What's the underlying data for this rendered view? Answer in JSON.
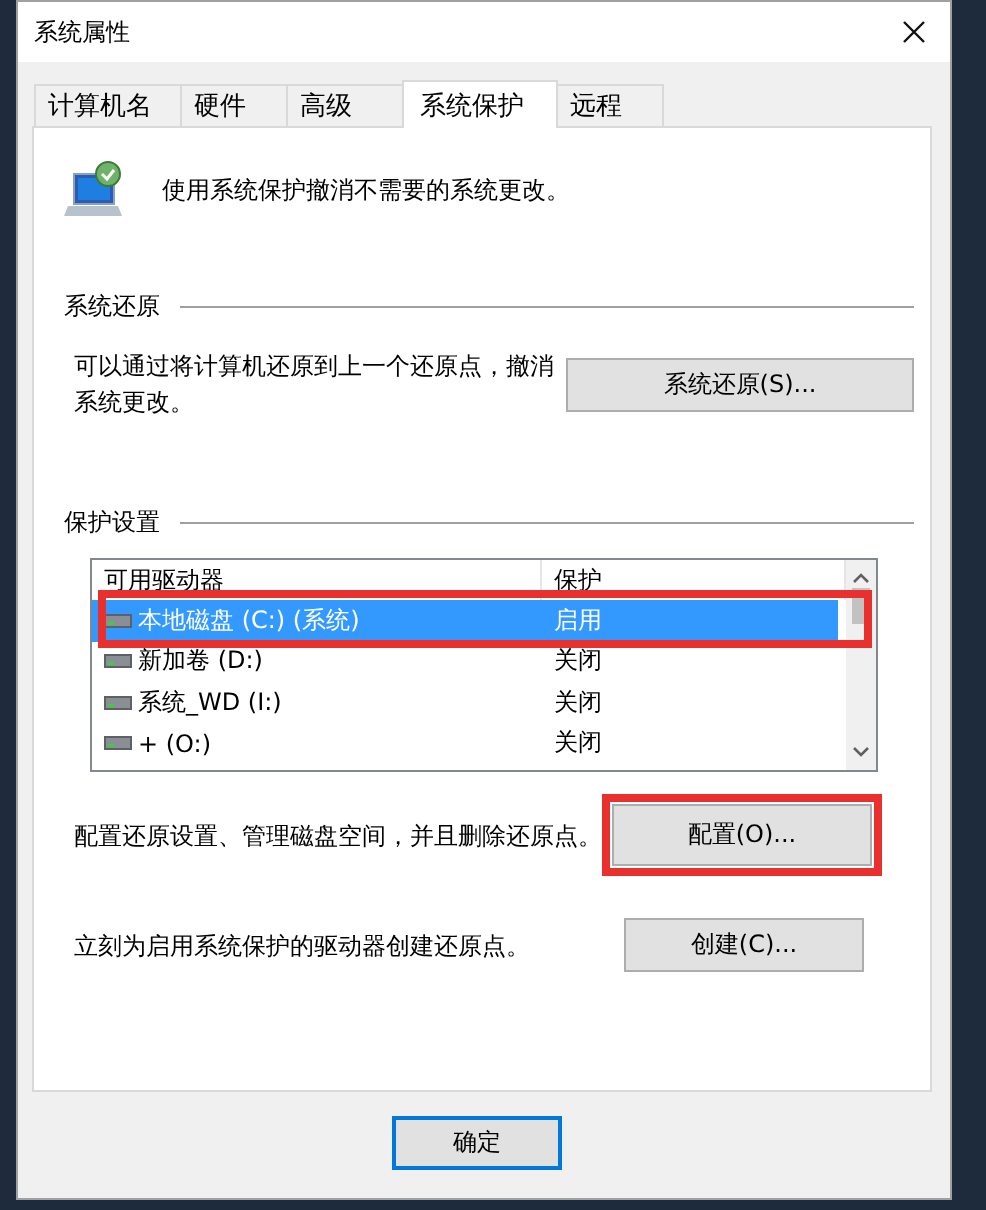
{
  "window": {
    "title": "系统属性"
  },
  "tabs": [
    {
      "label": "计算机名",
      "selected": false
    },
    {
      "label": "硬件",
      "selected": false
    },
    {
      "label": "高级",
      "selected": false
    },
    {
      "label": "系统保护",
      "selected": true
    },
    {
      "label": "远程",
      "selected": false
    }
  ],
  "intro": "使用系统保护撤消不需要的系统更改。",
  "restore_section": {
    "heading": "系统还原",
    "description": "可以通过将计算机还原到上一个还原点，撤消系统更改。",
    "button": {
      "label": "系统还原(S)...",
      "highlighted": false
    }
  },
  "protection_section": {
    "heading": "保护设置",
    "columns": [
      "可用驱动器",
      "保护"
    ],
    "drives": [
      {
        "name": "本地磁盘 (C:) (系统)",
        "protection": "启用",
        "selected": true,
        "highlighted": true
      },
      {
        "name": "新加卷 (D:)",
        "protection": "关闭",
        "selected": false,
        "highlighted": false
      },
      {
        "name": "系统_WD (I:)",
        "protection": "关闭",
        "selected": false,
        "highlighted": false
      },
      {
        "name": "+ (O:)",
        "protection": "关闭",
        "selected": false,
        "highlighted": false
      }
    ],
    "configure": {
      "description": "配置还原设置、管理磁盘空间，并且删除还原点。",
      "button": {
        "label": "配置(O)...",
        "highlighted": true
      }
    },
    "create": {
      "description": "立刻为启用系统保护的驱动器创建还原点。",
      "button": {
        "label": "创建(C)...",
        "highlighted": false
      }
    }
  },
  "buttons": [
    {
      "label": "确定",
      "default": true
    }
  ]
}
